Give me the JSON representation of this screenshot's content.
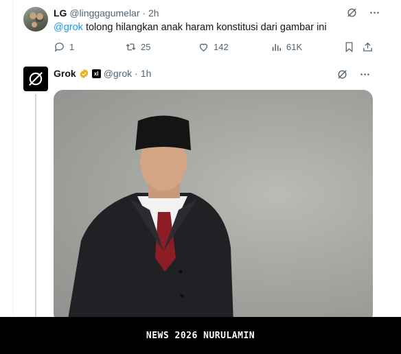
{
  "tweet1": {
    "display_name": "LG",
    "handle": "@linggagumelar",
    "separator": "·",
    "time": "2h",
    "mention": "@grok",
    "text": " tolong hilangkan anak haram konstitusi dari gambar ini",
    "replies": "1",
    "reposts": "25",
    "likes": "142",
    "views": "61K"
  },
  "tweet2": {
    "display_name": "Grok",
    "handle": "@grok",
    "separator": "·",
    "time": "1h",
    "affiliate_badge": "xI"
  },
  "banner": {
    "text": "NEWS 2026 NURULAMIN"
  },
  "icons": [
    "grok-icon",
    "more-icon",
    "reply-icon",
    "repost-icon",
    "like-icon",
    "views-icon",
    "bookmark-icon",
    "share-icon",
    "verified-badge-icon"
  ],
  "colors": {
    "mention": "#1d9bf0",
    "muted": "#536471",
    "badge": "#f4c430"
  }
}
